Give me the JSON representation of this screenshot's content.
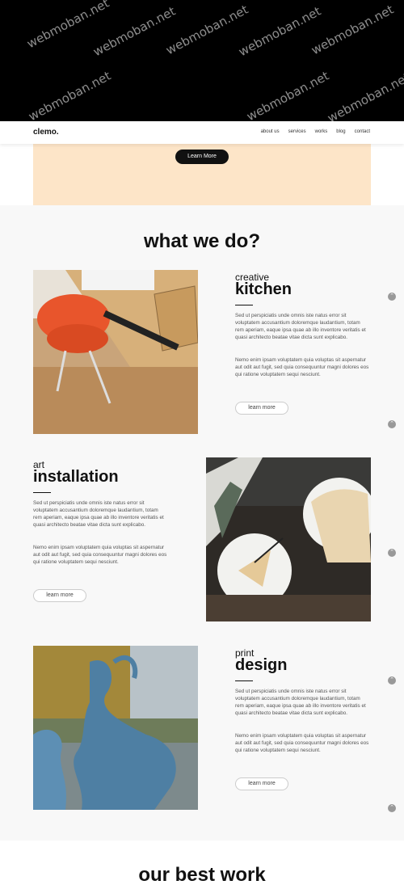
{
  "watermark": "webmoban.net",
  "nav": {
    "logo": "clemo.",
    "links": [
      "about us",
      "services",
      "works",
      "blog",
      "contact"
    ]
  },
  "hero": {
    "button_label": "Learn More"
  },
  "what_we_do": {
    "title": "what we do?",
    "items": [
      {
        "kicker": "creative",
        "heading": "kitchen",
        "para1": "Sed ut perspiciatis unde omnis iste natus error sit voluptatem accusantium doloremque laudantium, totam rem aperiam, eaque ipsa quae ab illo inventore veritatis et quasi architecto beatae vitae dicta sunt explicabo.",
        "para2": "Nemo enim ipsam voluptatem quia voluptas sit aspernatur aut odit aut fugit, sed quia consequuntur magni dolores eos qui ratione voluptatem sequi nesciunt.",
        "button": "learn more"
      },
      {
        "kicker": "art",
        "heading": "installation",
        "para1": "Sed ut perspiciatis unde omnis iste natus error sit voluptatem accusantium doloremque laudantium, totam rem aperiam, eaque ipsa quae ab illo inventore veritatis et quasi architecto beatae vitae dicta sunt explicabo.",
        "para2": "Nemo enim ipsam voluptatem quia voluptas sit aspernatur aut odit aut fugit, sed quia consequuntur magni dolores eos qui ratione voluptatem sequi nesciunt.",
        "button": "learn more"
      },
      {
        "kicker": "print",
        "heading": "design",
        "para1": "Sed ut perspiciatis unde omnis iste natus error sit voluptatem accusantium doloremque laudantium, totam rem aperiam, eaque ipsa quae ab illo inventore veritatis et quasi architecto beatae vitae dicta sunt explicabo.",
        "para2": "Nemo enim ipsam voluptatem quia voluptas sit aspernatur aut odit aut fugit, sed quia consequuntur magni dolores eos qui ratione voluptatem sequi nesciunt.",
        "button": "learn more"
      }
    ]
  },
  "our_best_work": {
    "title": "our best work"
  },
  "icons": {
    "scroll": "chevron-up-icon"
  },
  "colors": {
    "hero_bg": "#fde5c8",
    "accent": "#111111"
  }
}
